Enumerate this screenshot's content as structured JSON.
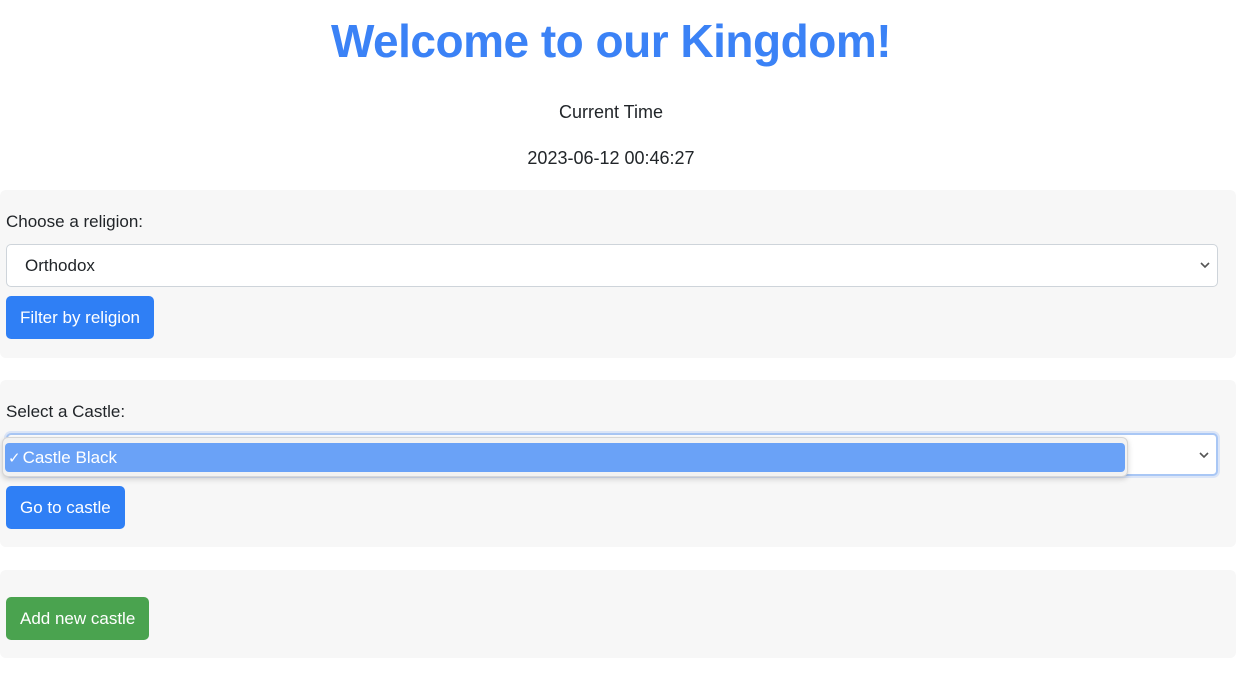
{
  "header": {
    "title": "Welcome to our Kingdom!",
    "time_label": "Current Time",
    "time_value": "2023-06-12 00:46:27"
  },
  "religion_section": {
    "label": "Choose a religion:",
    "selected": "Orthodox",
    "button": "Filter by religion"
  },
  "castle_section": {
    "label": "Select a Castle:",
    "selected": "Castle Black",
    "dropdown_open": true,
    "options": [
      {
        "label": "Castle Black",
        "checked": true
      }
    ],
    "button": "Go to castle"
  },
  "add_section": {
    "button": "Add new castle"
  },
  "colors": {
    "title": "#3b82f6",
    "primary_button": "#2f7ff5",
    "success_button": "#4aa34f",
    "panel_bg": "#f7f7f7",
    "highlight": "#6aa2f7"
  },
  "icons": {
    "select_chevron": "chevron-down-icon",
    "option_check": "check-icon"
  }
}
